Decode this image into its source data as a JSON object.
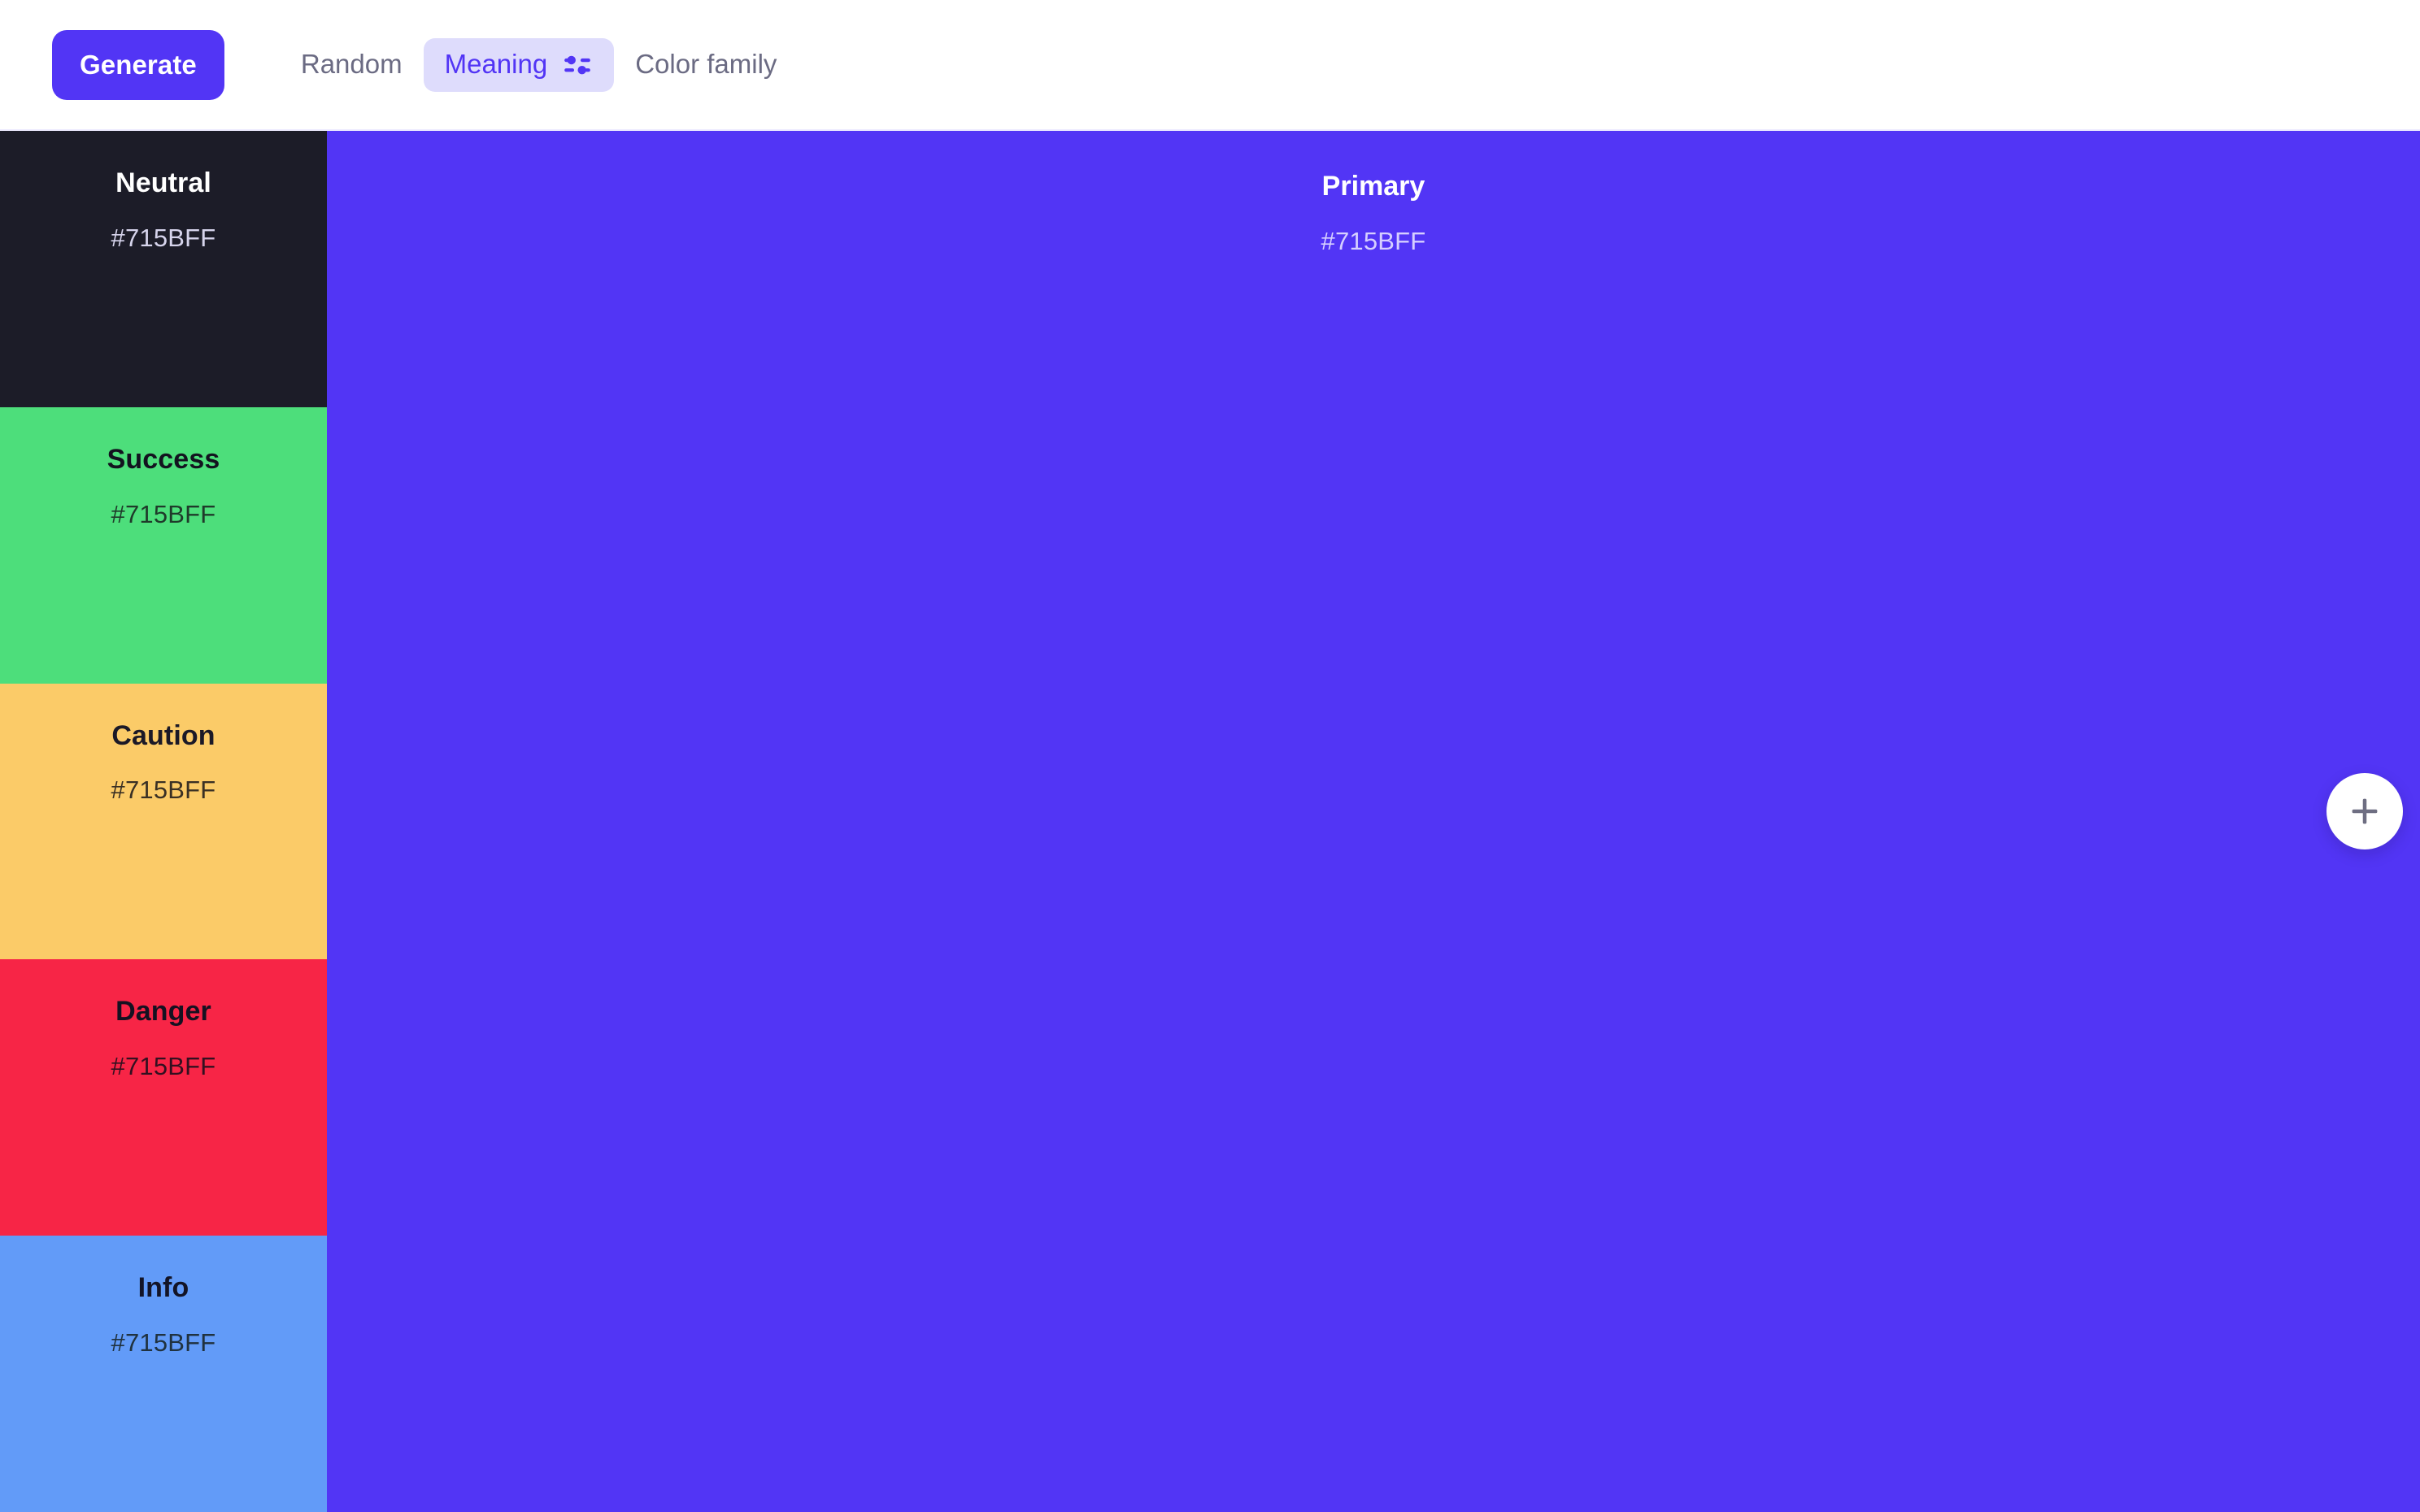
{
  "toolbar": {
    "generate_label": "Generate",
    "tabs": [
      {
        "label": "Random",
        "active": false,
        "icon": null
      },
      {
        "label": "Meaning",
        "active": true,
        "icon": "sliders-icon"
      },
      {
        "label": "Color family",
        "active": false,
        "icon": null
      }
    ],
    "active_tab": "Meaning",
    "accent_color": "#5235F5",
    "active_tab_bg": "#DEDCFC",
    "inactive_tab_text": "#6B6B83"
  },
  "palette": {
    "primary": {
      "name": "Primary",
      "hex": "#715BFF",
      "swatch_color": "#5235F5",
      "name_color": "#FFFFFF",
      "hex_color": "#D6CFFF"
    },
    "semantic": [
      {
        "name": "Neutral",
        "hex": "#715BFF",
        "swatch_color": "#1C1C28",
        "name_color": "#FFFFFF",
        "hex_color": "#D6D4EC"
      },
      {
        "name": "Success",
        "hex": "#715BFF",
        "swatch_color": "#4DDE7B",
        "name_color": "#13131F",
        "hex_color": "#1F3A2A"
      },
      {
        "name": "Caution",
        "hex": "#715BFF",
        "swatch_color": "#FBCB68",
        "name_color": "#1B1927",
        "hex_color": "#3A3024"
      },
      {
        "name": "Danger",
        "hex": "#715BFF",
        "swatch_color": "#F72546",
        "name_color": "#151121",
        "hex_color": "#331020"
      },
      {
        "name": "Info",
        "hex": "#715BFF",
        "swatch_color": "#629BF8",
        "name_color": "#131427",
        "hex_color": "#20323F"
      }
    ]
  },
  "fab": {
    "icon": "plus-icon",
    "label": "+",
    "icon_color": "#6E6E82",
    "background": "#FFFFFF"
  }
}
